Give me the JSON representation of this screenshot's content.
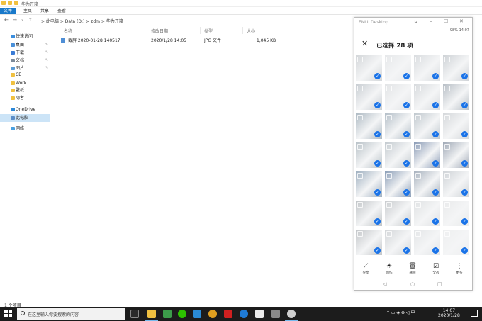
{
  "window": {
    "title": "华为开箱"
  },
  "ribbon": {
    "tabs": [
      "文件",
      "主页",
      "共享",
      "查看"
    ]
  },
  "address": {
    "crumbs": "> 此电脑 > Data (D:) > zdm > 华为开箱"
  },
  "sidebar": {
    "items": [
      {
        "label": "快速访问",
        "color": "#3b8ede"
      },
      {
        "label": "桌面",
        "color": "#4a90d9",
        "pinned": true
      },
      {
        "label": "下载",
        "color": "#3a7bd5",
        "pinned": true
      },
      {
        "label": "文档",
        "color": "#7c8a99",
        "pinned": true
      },
      {
        "label": "图片",
        "color": "#5b9bd5",
        "pinned": true
      },
      {
        "label": "CE",
        "color": "#f0c040"
      },
      {
        "label": "Work",
        "color": "#f0c040"
      },
      {
        "label": "壁纸",
        "color": "#f0c040"
      },
      {
        "label": "隐者",
        "color": "#f0c040"
      },
      {
        "label": "OneDrive",
        "color": "#2b88d8"
      },
      {
        "label": "此电脑",
        "color": "#5a8ec9",
        "selected": true
      },
      {
        "label": "网络",
        "color": "#4aa0e0"
      }
    ]
  },
  "columns": [
    "名称",
    "修改日期",
    "类型",
    "大小"
  ],
  "files": [
    {
      "name": "截屏 2020-01-28 140517",
      "date": "2020/1/28 14:05",
      "type": "JPG 文件",
      "size": "1,045 KB"
    }
  ],
  "status": {
    "text": "1 个项目"
  },
  "taskbar": {
    "search_placeholder": "在这里输入你要搜索的内容",
    "time": "14:07",
    "date": "2020/1/28",
    "ime": "中"
  },
  "phone": {
    "window_title": "EMUI Desktop",
    "status_left": "",
    "status_right": "98% 14:07",
    "selection_title": "已选择 28 项",
    "actions": [
      {
        "label": "分享",
        "icon": "share-icon"
      },
      {
        "label": "创作",
        "icon": "bulb-icon"
      },
      {
        "label": "删除",
        "icon": "trash-icon"
      },
      {
        "label": "全选",
        "icon": "select-all-icon"
      },
      {
        "label": "更多",
        "icon": "more-icon"
      }
    ],
    "photos": [
      "#d3d6d9",
      "#e6e8ea",
      "#d9dcdf",
      "#ced2d6",
      "#c9ced3",
      "#e2e4e6",
      "#d7dadd",
      "#b8bfc6",
      "#aebac3",
      "#b4bfc8",
      "#c0c8ce",
      "#d5d8db",
      "#b9c2c8",
      "#c4cbd0",
      "#8a9bb6",
      "#a0a9b6",
      "#9fb0c0",
      "#8c9fb8",
      "#a8b2be",
      "#cfd3d7",
      "#bfc3c6",
      "#c8cbce",
      "#dfe1e3",
      "#e9eaeb",
      "#c2c5c8",
      "#d2d5d8",
      "#e3e5e7",
      "#eeeff0"
    ]
  }
}
